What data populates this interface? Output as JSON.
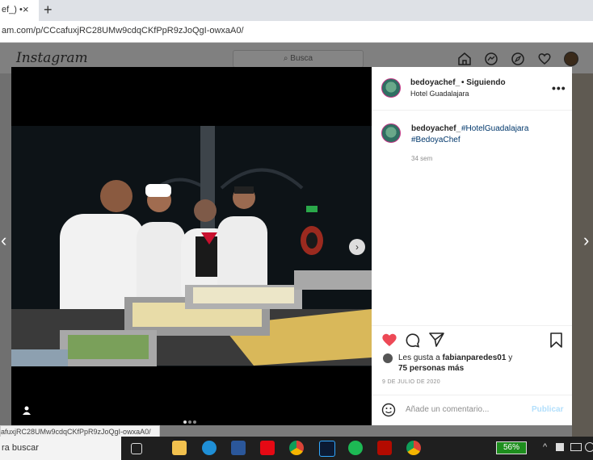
{
  "browser": {
    "tab_title": "ef_) •",
    "tab_close": "×",
    "new_tab": "+",
    "url": "am.com/p/CCcafuxjRC28UMw9cdqCKfPpR9zJoQgI-owxaA0/",
    "status_url": "afuxjRC28UMw9cdqCKfPpR9zJoQgI-owxaA0/"
  },
  "instagram": {
    "logo": "Instagram",
    "search_placeholder": "Busca",
    "nav_icons": [
      "home-icon",
      "messenger-icon",
      "explore-icon",
      "heart-icon",
      "profile-avatar"
    ]
  },
  "post": {
    "username": "bedoyachef_",
    "follow_status": "• Siguiendo",
    "location": "Hotel Guadalajara",
    "more_label": "•••",
    "caption_user": "bedoyachef_",
    "caption_tag1": "#HotelGuadalajara",
    "caption_tag2": "#BedoyaChef",
    "caption_age": "34 sem",
    "liked_prefix": "Les gusta a",
    "liked_user": "fabianparedes01",
    "liked_suffix": "y",
    "liked_others": "75 personas más",
    "date": "9 DE JULIO DE 2020",
    "comment_placeholder": "Añade un comentario...",
    "publish_label": "Publicar",
    "carousel_dots": 3,
    "active_dot": 1
  },
  "taskbar": {
    "search_text": "ra buscar",
    "battery": "56%",
    "apps": [
      "task-view-icon",
      "file-explorer-icon",
      "edge-icon",
      "word-icon",
      "netflix-icon",
      "chrome-icon",
      "photoshop-icon",
      "spotify-icon",
      "acrobat-icon",
      "chrome-alt-icon"
    ]
  },
  "colors": {
    "heart": "#ed4956",
    "hashtag": "#00376b",
    "publish": "#b2dffc",
    "battery": "#1e8e1e"
  }
}
